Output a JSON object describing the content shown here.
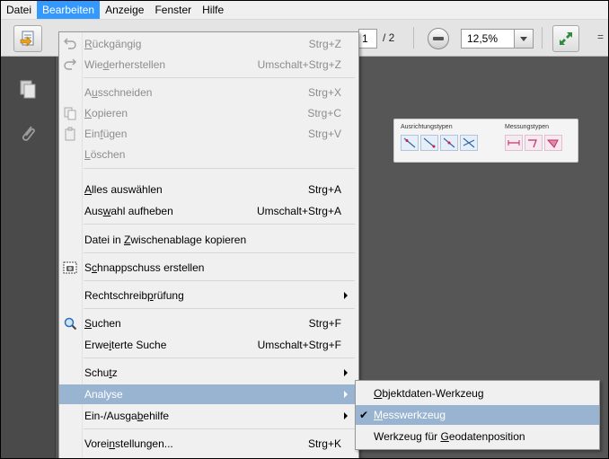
{
  "menubar": [
    "Datei",
    "Bearbeiten",
    "Anzeige",
    "Fenster",
    "Hilfe"
  ],
  "toolbar": {
    "page_current": "1",
    "page_total": "/ 2",
    "zoom": "12,5%",
    "overflow": "="
  },
  "panel": {
    "left_title": "Ausrichtungstypen",
    "right_title": "Messungstypen"
  },
  "menu": [
    {
      "pre": "",
      "u": "R",
      "post": "ückgängig",
      "shortcut": "Strg+Z",
      "disabled": true,
      "icon": "undo-icon"
    },
    {
      "pre": "Wie",
      "u": "d",
      "post": "erherstellen",
      "shortcut": "Umschalt+Strg+Z",
      "disabled": true,
      "icon": "redo-icon"
    },
    {
      "pre": "A",
      "u": "u",
      "post": "sschneiden",
      "shortcut": "Strg+X",
      "disabled": true,
      "icon": ""
    },
    {
      "pre": "",
      "u": "K",
      "post": "opieren",
      "shortcut": "Strg+C",
      "disabled": true,
      "icon": "copy-icon"
    },
    {
      "pre": "Ein",
      "u": "f",
      "post": "ügen",
      "shortcut": "Strg+V",
      "disabled": true,
      "icon": "paste-icon"
    },
    {
      "pre": "",
      "u": "L",
      "post": "öschen",
      "shortcut": "",
      "disabled": true,
      "icon": ""
    },
    {
      "pre": "",
      "u": "A",
      "post": "lles auswählen",
      "shortcut": "Strg+A",
      "disabled": false,
      "icon": ""
    },
    {
      "pre": "Aus",
      "u": "w",
      "post": "ahl aufheben",
      "shortcut": "Umschalt+Strg+A",
      "disabled": false,
      "icon": ""
    },
    {
      "pre": "Datei in ",
      "u": "Z",
      "post": "wischenablage kopieren",
      "shortcut": "",
      "disabled": false,
      "icon": ""
    },
    {
      "pre": "S",
      "u": "c",
      "post": "hnappschuss erstellen",
      "shortcut": "",
      "disabled": false,
      "icon": "camera-icon"
    },
    {
      "pre": "Rechtschreib",
      "u": "p",
      "post": "rüfung",
      "shortcut": "",
      "disabled": false,
      "icon": "",
      "sub": true
    },
    {
      "pre": "",
      "u": "S",
      "post": "uchen",
      "shortcut": "Strg+F",
      "disabled": false,
      "icon": "search-icon"
    },
    {
      "pre": "Erwe",
      "u": "i",
      "post": "terte Suche",
      "shortcut": "Umschalt+Strg+F",
      "disabled": false,
      "icon": ""
    },
    {
      "pre": "Schu",
      "u": "t",
      "post": "z",
      "shortcut": "",
      "disabled": false,
      "icon": "",
      "sub": true
    },
    {
      "pre": "Analyse",
      "u": "",
      "post": "",
      "shortcut": "",
      "disabled": false,
      "icon": "",
      "sub": true,
      "highlight": true
    },
    {
      "pre": "Ein-/Ausga",
      "u": "b",
      "post": "ehilfe",
      "shortcut": "",
      "disabled": false,
      "icon": "",
      "sub": true
    },
    {
      "pre": "Vorei",
      "u": "n",
      "post": "stellungen...",
      "shortcut": "Strg+K",
      "disabled": false,
      "icon": ""
    }
  ],
  "submenu": [
    {
      "pre": "",
      "u": "O",
      "post": "bjektdaten-Werkzeug",
      "checked": false
    },
    {
      "pre": "",
      "u": "M",
      "post": "esswerkzeug",
      "checked": true,
      "highlight": true,
      "check": "✔"
    },
    {
      "pre": "Werkzeug für ",
      "u": "G",
      "post": "eodatenposition",
      "checked": false
    }
  ]
}
